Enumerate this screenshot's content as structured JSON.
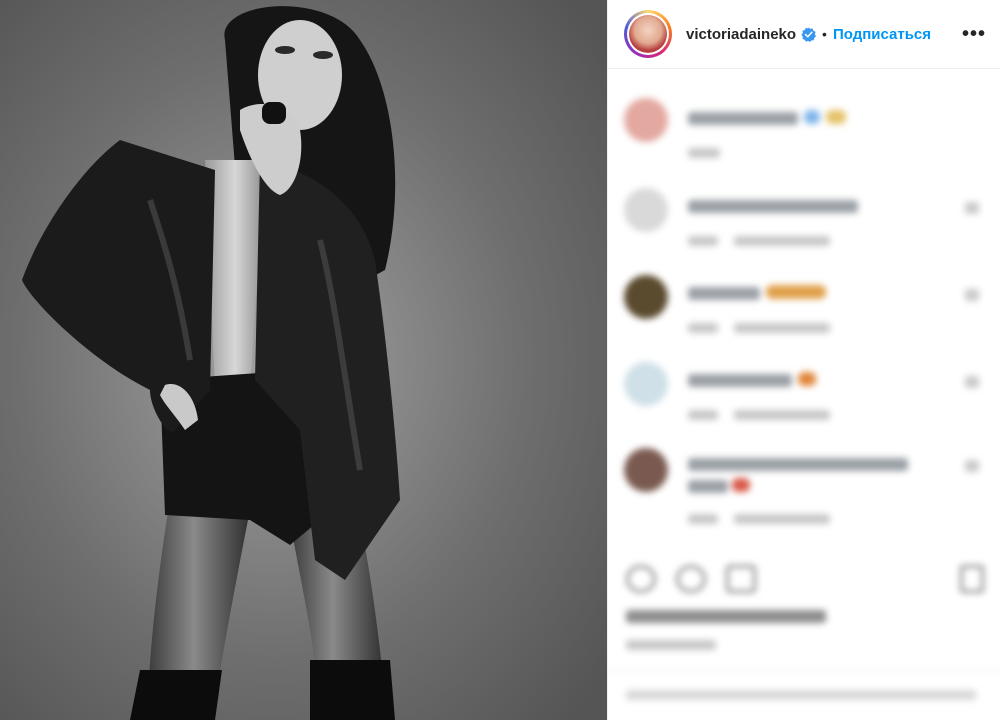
{
  "post": {
    "username": "victoriadaineko",
    "follow_label": "Подписаться",
    "separator": "•",
    "more_label": "•••"
  },
  "colors": {
    "link_blue": "#0095f6",
    "verified_blue": "#3897f0",
    "text": "#262626"
  },
  "icons": {
    "verified": "verified-badge-icon",
    "more": "more-options-icon",
    "like": "heart-icon",
    "comment": "comment-icon",
    "share": "share-icon",
    "save": "bookmark-icon"
  }
}
